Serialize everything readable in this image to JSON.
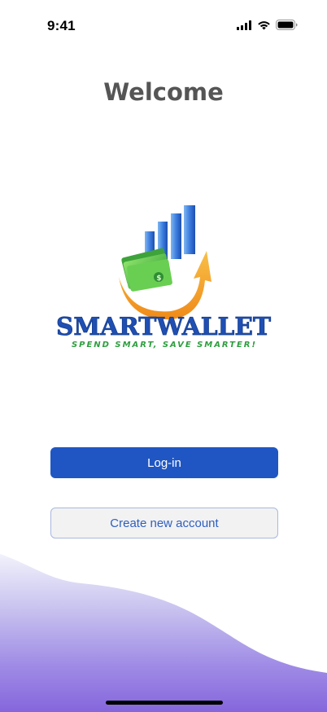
{
  "status_bar": {
    "time": "9:41",
    "icons": [
      "cellular-signal-icon",
      "wifi-icon",
      "battery-icon"
    ]
  },
  "page": {
    "title": "Welcome"
  },
  "logo": {
    "brand_name": "SMARTWALLET",
    "tagline": "SPEND SMART, SAVE SMARTER!",
    "colors": {
      "brand_blue": "#1f4fb3",
      "tagline_green": "#2e9e3f",
      "arrow_orange": "#f5a623",
      "money_green": "#5cc24a"
    }
  },
  "actions": {
    "login_label": "Log-in",
    "create_account_label": "Create new account"
  },
  "theme": {
    "primary": "#1f56c3",
    "wave_top": "#eef0fb",
    "wave_bottom": "#8b6ddf"
  }
}
